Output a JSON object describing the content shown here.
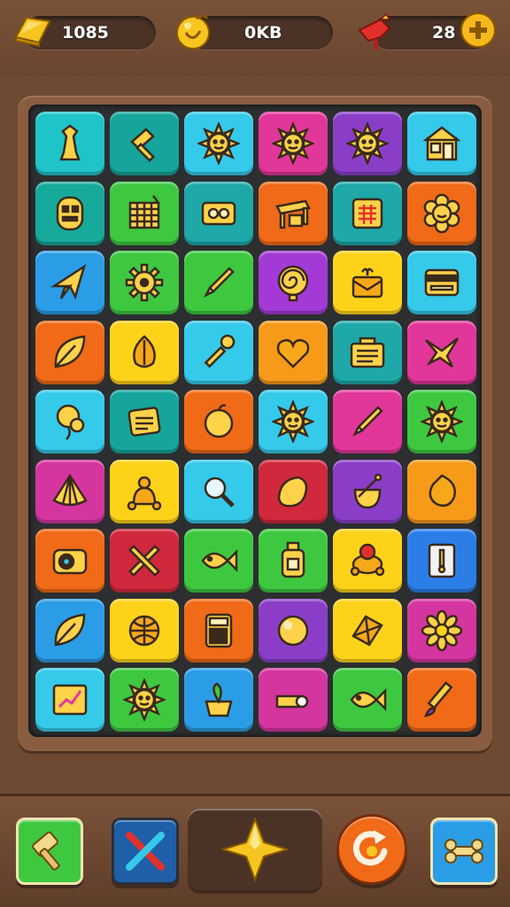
{
  "hud": {
    "gold": {
      "value": "1085",
      "icon": "gold-bar-icon"
    },
    "coins": {
      "value": "0KB",
      "icon": "coin-icon"
    },
    "boosters": {
      "value": "28",
      "icon": "red-flag-icon",
      "add_icon": "plus-icon"
    }
  },
  "board": {
    "rows": 9,
    "cols": 6,
    "tiles": [
      [
        {
          "color": "#1ec4c8",
          "icon": "chess-piece-icon"
        },
        {
          "color": "#15a59b",
          "icon": "hammer-icon"
        },
        {
          "color": "#35c9ea",
          "icon": "sun-icon"
        },
        {
          "color": "#e2379a",
          "icon": "sun-icon"
        },
        {
          "color": "#8a3ec8",
          "icon": "sun-icon"
        },
        {
          "color": "#35c9ea",
          "icon": "house-icon"
        }
      ],
      [
        {
          "color": "#17aa9a",
          "icon": "mask-icon"
        },
        {
          "color": "#3ec840",
          "icon": "grid-board-icon"
        },
        {
          "color": "#1ea8a8",
          "icon": "cassette-icon"
        },
        {
          "color": "#f06a18",
          "icon": "desk-icon"
        },
        {
          "color": "#1ea8a8",
          "icon": "calendar-icon"
        },
        {
          "color": "#f06a18",
          "icon": "flower-face-icon"
        }
      ],
      [
        {
          "color": "#2b9de6",
          "icon": "star-shard-icon"
        },
        {
          "color": "#3ec840",
          "icon": "gear-icon"
        },
        {
          "color": "#3ec840",
          "icon": "pencil-icon"
        },
        {
          "color": "#a33ad6",
          "icon": "spiral-icon"
        },
        {
          "color": "#ffd21a",
          "icon": "gift-box-icon"
        },
        {
          "color": "#35c9ea",
          "icon": "card-icon"
        }
      ],
      [
        {
          "color": "#f06a18",
          "icon": "leaf-icon"
        },
        {
          "color": "#ffd21a",
          "icon": "garlic-icon"
        },
        {
          "color": "#35c9ea",
          "icon": "wand-icon"
        },
        {
          "color": "#f79a1a",
          "icon": "heart-box-icon"
        },
        {
          "color": "#1ea8a8",
          "icon": "toolbox-icon"
        },
        {
          "color": "#e2379a",
          "icon": "bird-icon"
        }
      ],
      [
        {
          "color": "#35c9ea",
          "icon": "balloon-icon"
        },
        {
          "color": "#15a59b",
          "icon": "note-icon"
        },
        {
          "color": "#f06a18",
          "icon": "apple-icon"
        },
        {
          "color": "#35c9ea",
          "icon": "sun-icon"
        },
        {
          "color": "#e2379a",
          "icon": "pencil-icon"
        },
        {
          "color": "#3ec840",
          "icon": "sun-icon"
        }
      ],
      [
        {
          "color": "#d5359e",
          "icon": "shell-icon"
        },
        {
          "color": "#ffd21a",
          "icon": "bell-icon"
        },
        {
          "color": "#35c9ea",
          "icon": "magnifier-icon"
        },
        {
          "color": "#d0283c",
          "icon": "lemon-icon"
        },
        {
          "color": "#8a3ec8",
          "icon": "bag-icon"
        },
        {
          "color": "#f79a1a",
          "icon": "fruit-icon"
        }
      ],
      [
        {
          "color": "#f06a18",
          "icon": "camera-icon"
        },
        {
          "color": "#d0283c",
          "icon": "crossed-tools-icon"
        },
        {
          "color": "#3ec840",
          "icon": "fish-icon"
        },
        {
          "color": "#3ec840",
          "icon": "bottle-icon"
        },
        {
          "color": "#ffd21a",
          "icon": "crab-icon"
        },
        {
          "color": "#2b7ee6",
          "icon": "door-icon"
        }
      ],
      [
        {
          "color": "#2b9de6",
          "icon": "leaf-icon"
        },
        {
          "color": "#ffd21a",
          "icon": "globe-icon"
        },
        {
          "color": "#f06a18",
          "icon": "calculator-icon"
        },
        {
          "color": "#8a3ec8",
          "icon": "orb-icon"
        },
        {
          "color": "#ffd21a",
          "icon": "gem-icon"
        },
        {
          "color": "#d5359e",
          "icon": "flower-icon"
        }
      ],
      [
        {
          "color": "#35c9ea",
          "icon": "chart-icon"
        },
        {
          "color": "#3ec840",
          "icon": "sun-icon"
        },
        {
          "color": "#2b9de6",
          "icon": "plant-pot-icon"
        },
        {
          "color": "#d5359e",
          "icon": "hand-icon"
        },
        {
          "color": "#3ec840",
          "icon": "fish-icon"
        },
        {
          "color": "#f06a18",
          "icon": "brush-icon"
        }
      ]
    ]
  },
  "toolbar": {
    "items": [
      {
        "name": "hammer-tool-button",
        "icon": "hammer-icon",
        "color": "#3ec840"
      },
      {
        "name": "swap-tool-button",
        "icon": "crossed-sticks-icon",
        "color": "#1f5fa8"
      },
      {
        "name": "star-tool-button",
        "icon": "star-icon",
        "color": "#4a3326"
      },
      {
        "name": "shuffle-tool-button",
        "icon": "shuffle-icon",
        "color": "#f06a18"
      },
      {
        "name": "bone-tool-button",
        "icon": "bone-icon",
        "color": "#2b9de6"
      }
    ]
  }
}
